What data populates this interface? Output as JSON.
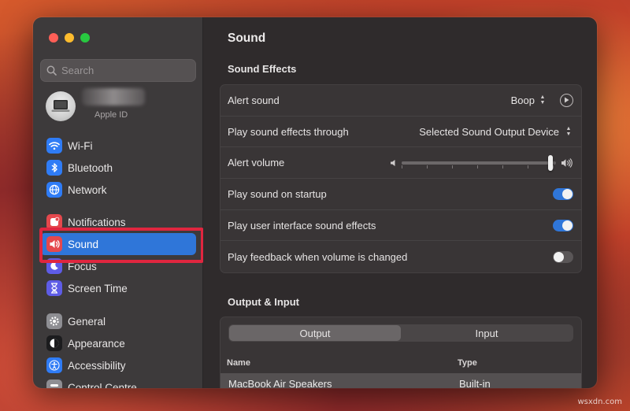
{
  "sidebar": {
    "search_placeholder": "Search",
    "apple_id_label": "Apple ID",
    "items": [
      {
        "label": "Wi-Fi",
        "icon": "wifi-icon",
        "color": "#2f7cf6"
      },
      {
        "label": "Bluetooth",
        "icon": "bluetooth-icon",
        "color": "#2f7cf6"
      },
      {
        "label": "Network",
        "icon": "globe-icon",
        "color": "#2f7cf6"
      },
      {
        "label": "Notifications",
        "icon": "bell-icon",
        "color": "#e5484d"
      },
      {
        "label": "Sound",
        "icon": "speaker-icon",
        "color": "#e5484d",
        "active": true
      },
      {
        "label": "Focus",
        "icon": "moon-icon",
        "color": "#5e5ce6"
      },
      {
        "label": "Screen Time",
        "icon": "hourglass-icon",
        "color": "#5e5ce6"
      },
      {
        "label": "General",
        "icon": "gear-icon",
        "color": "#8e8e93"
      },
      {
        "label": "Appearance",
        "icon": "appearance-icon",
        "color": "#1c1c1e"
      },
      {
        "label": "Accessibility",
        "icon": "accessibility-icon",
        "color": "#2f7cf6"
      },
      {
        "label": "Control Centre",
        "icon": "control-centre-icon",
        "color": "#8e8e93"
      }
    ]
  },
  "main": {
    "title": "Sound",
    "sound_effects": {
      "title": "Sound Effects",
      "alert_sound": {
        "label": "Alert sound",
        "value": "Boop"
      },
      "play_through": {
        "label": "Play sound effects through",
        "value": "Selected Sound Output Device"
      },
      "alert_volume": {
        "label": "Alert volume",
        "level": 0.98
      },
      "startup": {
        "label": "Play sound on startup",
        "on": true
      },
      "ui_effects": {
        "label": "Play user interface sound effects",
        "on": true
      },
      "feedback": {
        "label": "Play feedback when volume is changed",
        "on": false
      }
    },
    "output_input": {
      "title": "Output & Input",
      "tabs": [
        "Output",
        "Input"
      ],
      "active_tab": "Output",
      "columns": [
        "Name",
        "Type"
      ],
      "rows": [
        {
          "name": "MacBook Air Speakers",
          "type": "Built-in"
        }
      ]
    }
  },
  "watermark": "wsxdn.com",
  "colors": {
    "accent": "#2f76d9",
    "highlight": "#e0263f"
  }
}
